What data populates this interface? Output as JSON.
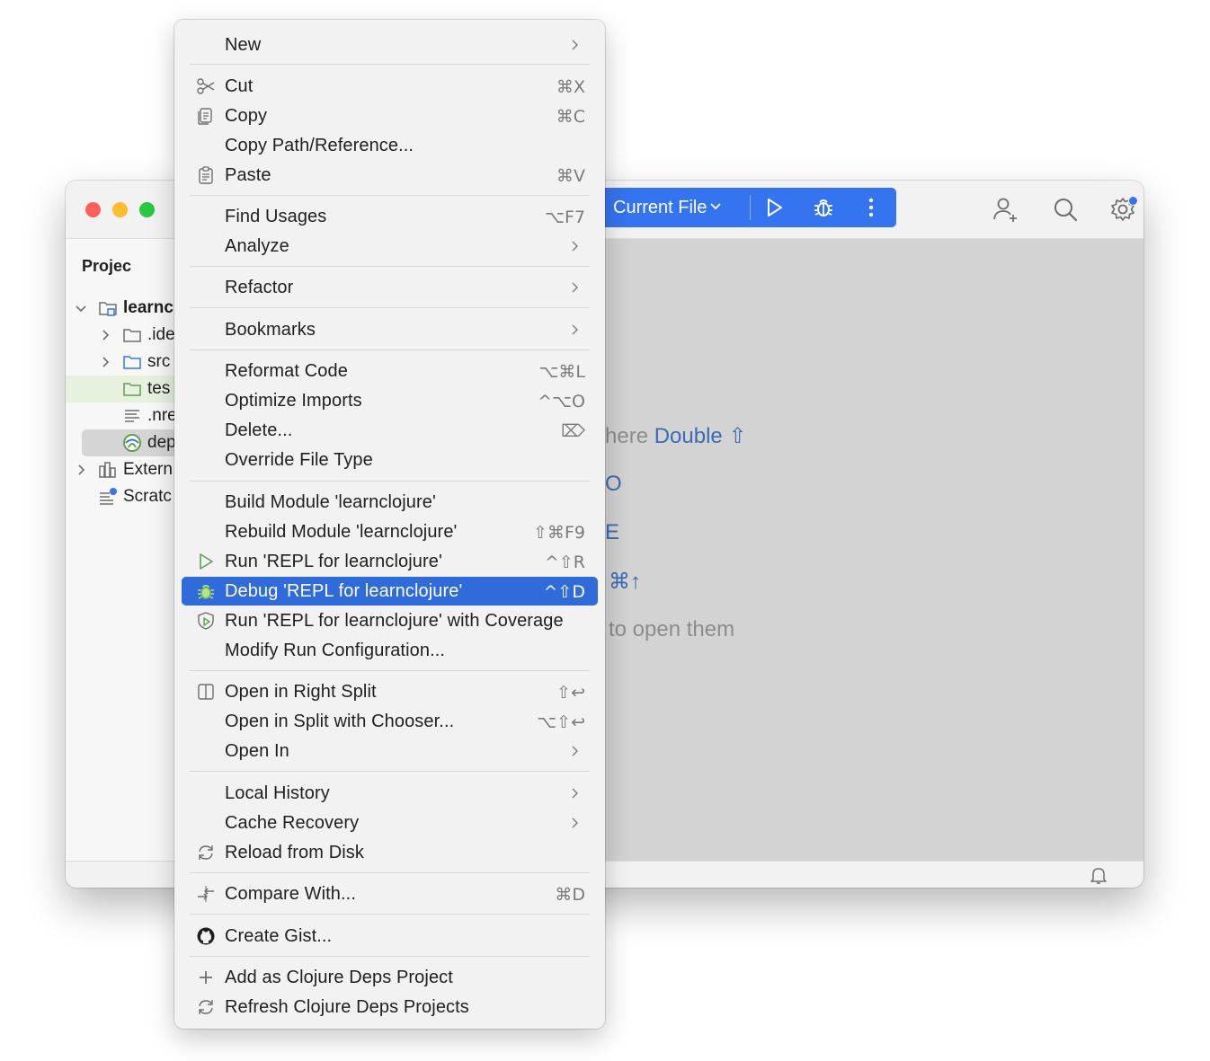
{
  "window": {
    "run_widget": {
      "config_label": "Current File"
    },
    "project_pane": {
      "title": "Projec",
      "tree": [
        {
          "label": "learnc",
          "bold": true
        },
        {
          "label": ".ide"
        },
        {
          "label": "src"
        },
        {
          "label": "tes"
        },
        {
          "label": ".nre"
        },
        {
          "label": "dep"
        },
        {
          "label": "Extern"
        },
        {
          "label": "Scratc"
        }
      ]
    },
    "editor_hints": {
      "line1_text": "here",
      "line1_kbd": "Double ⇧",
      "line2_kbd": "O",
      "line3_kbd": "E",
      "line4_kbd": "⌘↑",
      "line5_text": "to open them"
    }
  },
  "menu": {
    "items": [
      {
        "label": "New",
        "shortcut": "",
        "submenu": true
      },
      {
        "label": "Cut",
        "shortcut": "⌘X",
        "icon": "scissors-icon"
      },
      {
        "label": "Copy",
        "shortcut": "⌘C",
        "icon": "copy-icon"
      },
      {
        "label": "Copy Path/Reference...",
        "shortcut": ""
      },
      {
        "label": "Paste",
        "shortcut": "⌘V",
        "icon": "clipboard-icon"
      },
      {
        "label": "Find Usages",
        "shortcut": "⌥F7"
      },
      {
        "label": "Analyze",
        "shortcut": "",
        "submenu": true
      },
      {
        "label": "Refactor",
        "shortcut": "",
        "submenu": true
      },
      {
        "label": "Bookmarks",
        "shortcut": "",
        "submenu": true
      },
      {
        "label": "Reformat Code",
        "shortcut": "⌥⌘L"
      },
      {
        "label": "Optimize Imports",
        "shortcut": "^⌥O"
      },
      {
        "label": "Delete...",
        "shortcut": "⌦"
      },
      {
        "label": "Override File Type",
        "shortcut": ""
      },
      {
        "label": "Build Module 'learnclojure'",
        "shortcut": ""
      },
      {
        "label": "Rebuild Module 'learnclojure'",
        "shortcut": "⇧⌘F9"
      },
      {
        "label": "Run 'REPL for learnclojure'",
        "shortcut": "^⇧R",
        "icon": "run-icon"
      },
      {
        "label": "Debug 'REPL for learnclojure'",
        "shortcut": "^⇧D",
        "icon": "debug-icon",
        "active": true
      },
      {
        "label": "Run 'REPL for learnclojure' with Coverage",
        "shortcut": "",
        "icon": "coverage-icon"
      },
      {
        "label": "Modify Run Configuration...",
        "shortcut": ""
      },
      {
        "label": "Open in Right Split",
        "shortcut": "⇧↩",
        "icon": "split-icon"
      },
      {
        "label": "Open in Split with Chooser...",
        "shortcut": "⌥⇧↩"
      },
      {
        "label": "Open In",
        "shortcut": "",
        "submenu": true
      },
      {
        "label": "Local History",
        "shortcut": "",
        "submenu": true
      },
      {
        "label": "Cache Recovery",
        "shortcut": "",
        "submenu": true
      },
      {
        "label": "Reload from Disk",
        "shortcut": "",
        "icon": "reload-icon"
      },
      {
        "label": "Compare With...",
        "shortcut": "⌘D",
        "icon": "compare-icon"
      },
      {
        "label": "Create Gist...",
        "shortcut": "",
        "icon": "github-icon"
      },
      {
        "label": "Add as Clojure Deps Project",
        "shortcut": "",
        "icon": "plus-icon"
      },
      {
        "label": "Refresh Clojure Deps Projects",
        "shortcut": "",
        "icon": "refresh-icon"
      }
    ]
  },
  "colors": {
    "accent": "#3574f0",
    "menu_highlight": "#2f6bda",
    "menu_background": "#f2f2f2",
    "editor_background": "#d3d3d3"
  }
}
